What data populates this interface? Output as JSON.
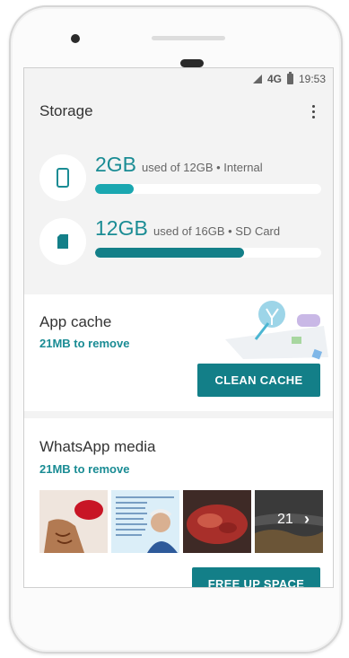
{
  "status": {
    "network": "4G",
    "time": "19:53"
  },
  "appbar": {
    "title": "Storage",
    "menu_icon": "more-vert-icon"
  },
  "storage": [
    {
      "icon": "phone-icon",
      "amount": "2GB",
      "detail": "used of 12GB • Internal",
      "progress": 0.17,
      "color": "#1aa7b0"
    },
    {
      "icon": "sd-card-icon",
      "amount": "12GB",
      "detail": "used of 16GB • SD Card",
      "progress": 0.66,
      "color": "#137f88"
    }
  ],
  "app_cache": {
    "title": "App cache",
    "subtitle": "21MB to remove",
    "button": "CLEAN CACHE"
  },
  "whatsapp": {
    "title": "WhatsApp media",
    "subtitle": "21MB to remove",
    "more_count": "21",
    "button": "FREE UP SPACE"
  },
  "colors": {
    "accent": "#1a8c94",
    "button": "#137f88"
  }
}
